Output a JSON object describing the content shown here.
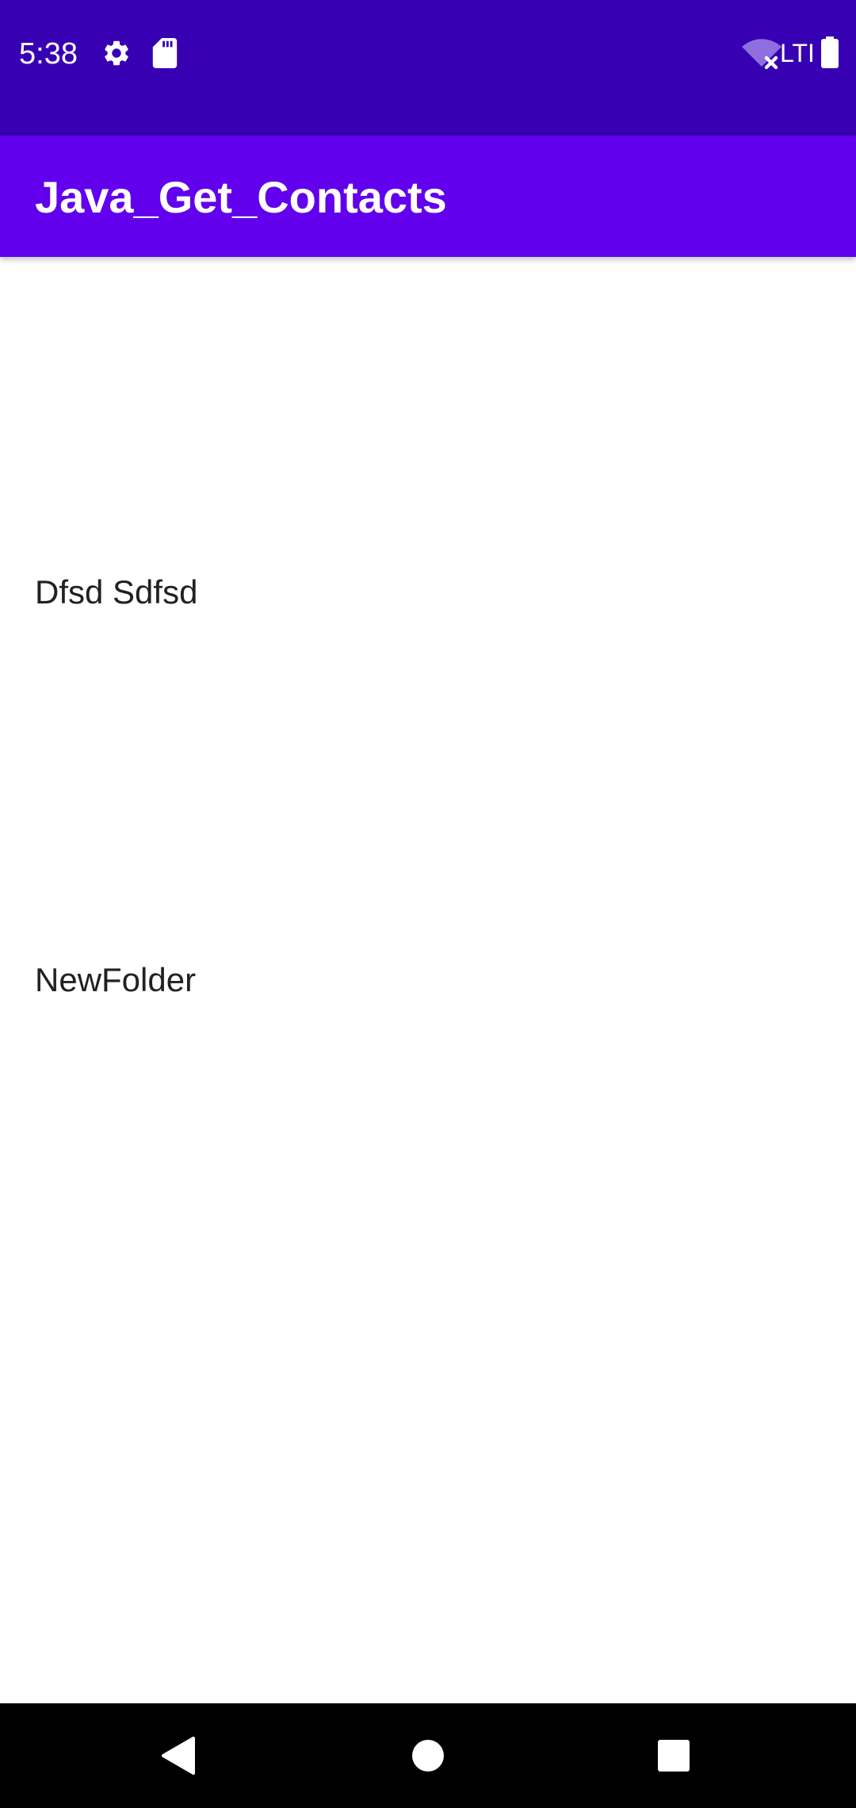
{
  "status_bar": {
    "time": "5:38",
    "network": "LTI",
    "icons": [
      "gear-icon",
      "sd-card-icon",
      "wifi-off-icon",
      "battery-icon"
    ],
    "background": "#3700b3"
  },
  "app_bar": {
    "title": "Java_Get_Contacts",
    "background": "#6200ee"
  },
  "contacts": [
    {
      "name": "Dfsd Sdfsd"
    },
    {
      "name": "NewFolder"
    }
  ],
  "nav_bar": {
    "buttons": [
      "back-icon",
      "home-icon",
      "recents-icon"
    ],
    "background": "#000000"
  }
}
